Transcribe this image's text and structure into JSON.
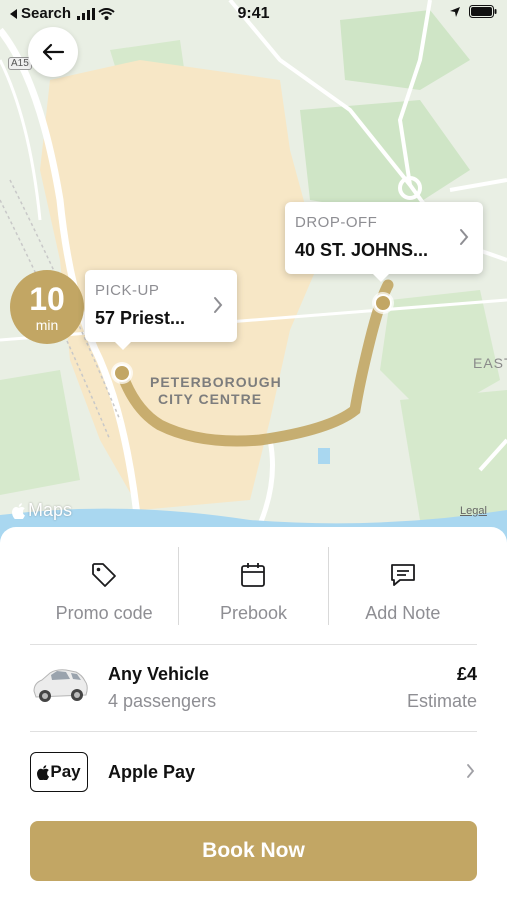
{
  "status_bar": {
    "back_app": "Search",
    "time": "9:41"
  },
  "map": {
    "eta": {
      "value": "10",
      "unit": "min"
    },
    "pickup": {
      "label": "PICK-UP",
      "address": "57 Priest..."
    },
    "dropoff": {
      "label": "DROP-OFF",
      "address": "40 ST. JOHNS..."
    },
    "area_label_line1": "PETERBOROUGH",
    "area_label_line2": "CITY CENTRE",
    "east_label": "EAST",
    "road_label": "A15",
    "maps_label": "Maps",
    "legal": "Legal",
    "colors": {
      "route": "#c2a664",
      "map_bg": "#e9efe4",
      "urban": "#f7e7c6",
      "water": "#a9d7f0"
    }
  },
  "actions": [
    {
      "label": "Promo code",
      "icon": "tag-icon"
    },
    {
      "label": "Prebook",
      "icon": "calendar-icon"
    },
    {
      "label": "Add Note",
      "icon": "note-icon"
    }
  ],
  "vehicle": {
    "name": "Any Vehicle",
    "passengers": "4 passengers",
    "price": "£4",
    "price_note": "Estimate",
    "icon": "car-icon"
  },
  "payment": {
    "logo_text": "Pay",
    "name": "Apple Pay",
    "icon": "apple-pay-icon"
  },
  "book_button": "Book Now",
  "accent_color": "#c2a664"
}
